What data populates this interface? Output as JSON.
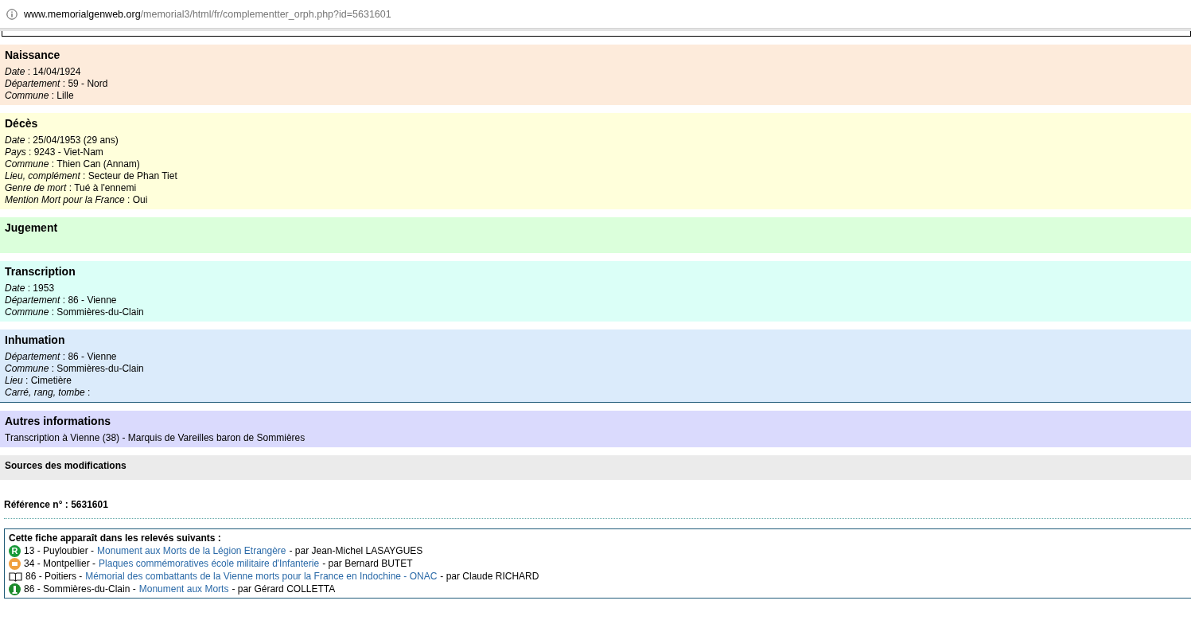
{
  "address_bar": {
    "host": "www.memorialgenweb.org",
    "path": "/memorial3/html/fr/complementter_orph.php?id=5631601"
  },
  "sections": [
    {
      "title": "Naissance",
      "color": "#fdebdb",
      "fields": [
        "*Date* : 14/04/1924",
        "*Département* : 59 - Nord",
        "*Commune* : Lille"
      ]
    },
    {
      "title": "Décès",
      "color": "#ffffdb",
      "fields": [
        "*Date* : 25/04/1953  (29 ans)",
        "*Pays* : 9243 - Viet-Nam",
        "*Commune* : Thien Can (Annam)",
        "*Lieu, complément* : Secteur de Phan Tiet",
        "*Genre de mort* : Tué à l'ennemi",
        "*Mention Mort pour la France* : Oui"
      ]
    },
    {
      "title": "Jugement",
      "color": "#dbffdb"
    },
    {
      "title": "Transcription",
      "color": "#dbfff7",
      "fields": [
        "*Date* : 1953",
        "*Département* : 86 - Vienne",
        "*Commune* : Sommières-du-Clain"
      ]
    },
    {
      "title": "Inhumation",
      "color": "#dbebfb",
      "fields": [
        "*Département* : 86 - Vienne",
        "*Commune* : Sommières-du-Clain",
        "*Lieu* : Cimetière",
        "*Carré, rang, tombe* :"
      ]
    }
  ],
  "autres": {
    "title": "Autres informations",
    "text": "Transcription à Vienne (38) - Marquis de Vareilles baron de Sommières"
  },
  "sources": {
    "title": "Sources des modifications"
  },
  "reference": "Référence n° : 5631601",
  "releves": {
    "title": "Cette fiche apparaît dans les relevés suivants :",
    "items": [
      {
        "kind": "letter",
        "icon_text": "R",
        "place": "13 - Puyloubier -",
        "link": "Monument aux Morts de la Légion Etrangère",
        "author": "- par Jean-Michel LASAYGUES"
      },
      {
        "kind": "plaque",
        "place": "34 - Montpellier -",
        "link": "Plaques commémoratives école militaire d'Infanterie",
        "author": "- par Bernard BUTET"
      },
      {
        "kind": "book",
        "place": "86 - Poitiers -",
        "link": "Mémorial des combattants de la Vienne morts pour la France en Indochine - ONAC",
        "author": "- par Claude RICHARD"
      },
      {
        "kind": "monument",
        "place": "86 - Sommières-du-Clain -",
        "link": "Monument aux Morts",
        "author": "- par Gérard COLLETTA"
      }
    ]
  }
}
